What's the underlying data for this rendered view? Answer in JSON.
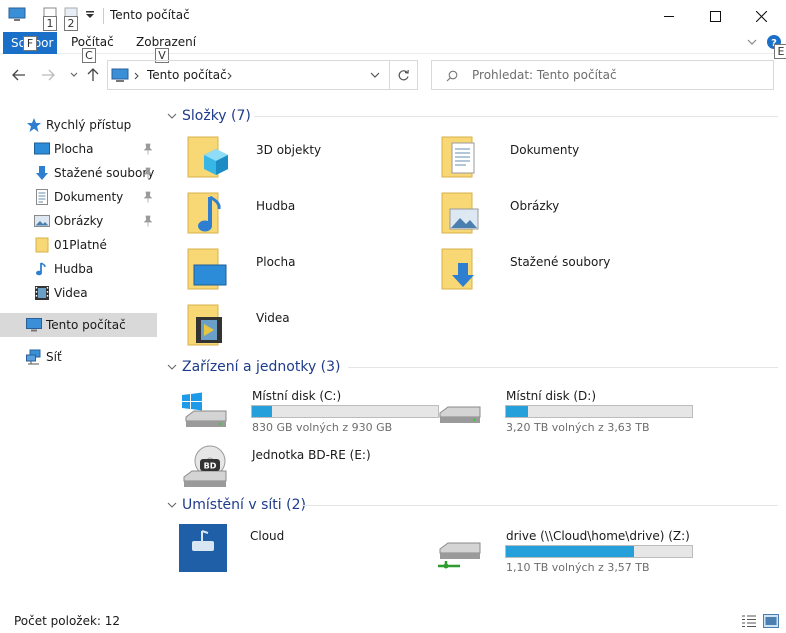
{
  "window": {
    "title": "Tento počítač",
    "keytips": {
      "qa1": "1",
      "qa2": "2",
      "file": "F",
      "computer": "C",
      "view": "V",
      "help": "E"
    }
  },
  "ribbon": {
    "tabs": [
      "Soubor",
      "Počítač",
      "Zobrazení"
    ],
    "accent": "#1a6fc9"
  },
  "address": {
    "location": "Tento počítač",
    "search_placeholder": "Prohledat: Tento počítač"
  },
  "sidebar": {
    "quick_access": "Rychlý přístup",
    "items": [
      {
        "label": "Plocha",
        "icon": "desktop-icon",
        "pinned": true
      },
      {
        "label": "Stažené soubory",
        "icon": "download-icon",
        "pinned": true
      },
      {
        "label": "Dokumenty",
        "icon": "documents-icon",
        "pinned": true
      },
      {
        "label": "Obrázky",
        "icon": "pictures-icon",
        "pinned": true
      },
      {
        "label": "01Platné",
        "icon": "folder-icon",
        "pinned": false
      },
      {
        "label": "Hudba",
        "icon": "music-icon",
        "pinned": false
      },
      {
        "label": "Videa",
        "icon": "video-icon",
        "pinned": false
      }
    ],
    "this_pc": "Tento počítač",
    "network": "Síť"
  },
  "groups": {
    "folders": {
      "title": "Složky (7)",
      "items": [
        "3D objekty",
        "Dokumenty",
        "Hudba",
        "Obrázky",
        "Plocha",
        "Stažené soubory",
        "Videa"
      ]
    },
    "devices": {
      "title": "Zařízení a jednotky (3)",
      "items": [
        {
          "name": "Místní disk (C:)",
          "free": "830 GB volných z 930 GB",
          "used_fraction": 0.11
        },
        {
          "name": "Místní disk (D:)",
          "free": "3,20 TB volných z 3,63 TB",
          "used_fraction": 0.12
        },
        {
          "name": "Jednotka BD-RE (E:)"
        }
      ]
    },
    "network": {
      "title": "Umístění v síti (2)",
      "items": [
        {
          "name": "Cloud"
        },
        {
          "name": "drive (\\\\Cloud\\home\\drive) (Z:)",
          "free": "1,10 TB volných z 3,57 TB",
          "used_fraction": 0.69
        }
      ]
    }
  },
  "status": {
    "item_count": "Počet položek: 12"
  },
  "colors": {
    "group_title": "#1e3c8c",
    "bar_fill": "#26a0da",
    "folder": "#f8d775"
  }
}
